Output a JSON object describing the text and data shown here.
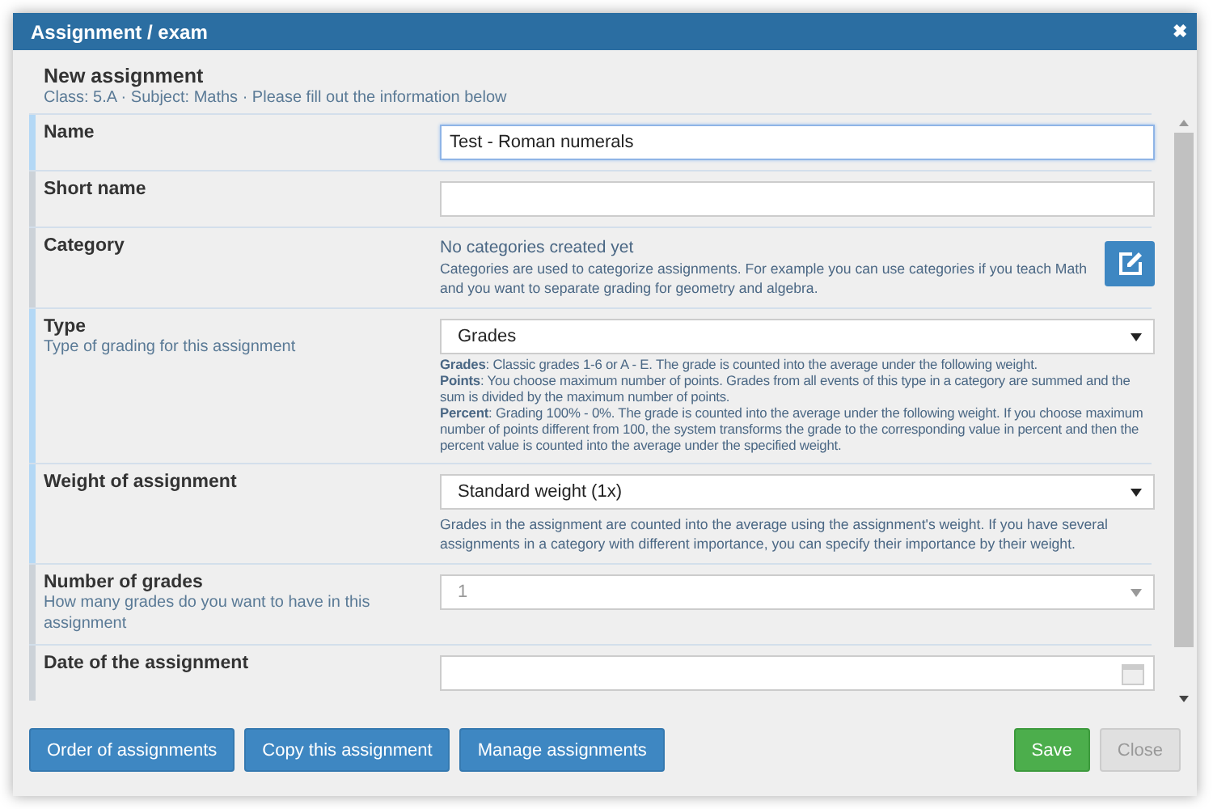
{
  "window": {
    "title": "Assignment / exam",
    "close": "✖"
  },
  "header": {
    "title": "New assignment",
    "subtitle": "Class: 5.A · Subject: Maths · Please fill out the information below"
  },
  "fields": [
    {
      "kind": "text",
      "label": "Name",
      "highlighted": true,
      "value": "Test - Roman numerals",
      "focused": true
    },
    {
      "kind": "text",
      "label": "Short name",
      "highlighted": false,
      "focused": false
    },
    {
      "kind": "info",
      "label": "Category",
      "highlighted": false,
      "message": "No categories created yet",
      "description": "Categories are used to categorize assignments. For example you can use categories if you teach Math and you want to separate grading for geometry and algebra."
    },
    {
      "kind": "select",
      "label": "Type",
      "hint": "Type of grading for this assignment",
      "highlighted": true,
      "value": "Grades",
      "disabled": false,
      "description_lines": [
        "**Grades**: Classic grades 1-6 or A - E. The grade is counted into the average under the following weight.",
        "**Points**: You choose maximum number of points. Grades from all events of this type in a category are summed and the sum is divided by the maximum number of points.",
        "**Percent**: Grading 100% - 0%. The grade is counted into the average under the following weight. If you choose maximum number of points different from 100, the system transforms the grade to the corresponding value in percent and then the percent value is counted into the average under the specified weight."
      ]
    },
    {
      "kind": "select",
      "label": "Weight of assignment",
      "highlighted": true,
      "value": "Standard weight (1x)",
      "disabled": false,
      "description_lines": [
        "Grades in the assignment are counted into the average using the assignment's weight. If you have several assignments in a category with different importance, you can specify their importance by their weight."
      ]
    },
    {
      "kind": "select",
      "label": "Number of grades",
      "hint": "How many grades do you want to have in this assignment",
      "highlighted": false,
      "value": "1",
      "disabled": true
    },
    {
      "kind": "date",
      "label": "Date of the assignment",
      "highlighted": false
    }
  ],
  "buttons": [
    {
      "label": "Order of assignments",
      "kind": "primary"
    },
    {
      "label": "Copy this assignment",
      "kind": "primary"
    },
    {
      "label": "Manage assignments",
      "kind": "primary"
    },
    {
      "label": "Save",
      "kind": "success"
    },
    {
      "label": "Close",
      "kind": "disabled"
    }
  ]
}
